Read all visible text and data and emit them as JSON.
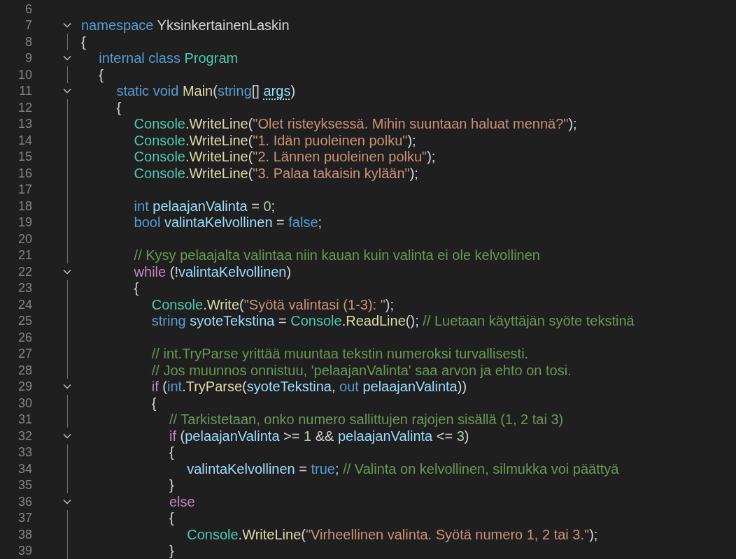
{
  "editor": {
    "lines": [
      {
        "number": "6",
        "fold": false,
        "guide": false
      },
      {
        "number": "7",
        "fold": true,
        "tokens": [
          {
            "kind": "kw",
            "text": "namespace "
          },
          {
            "kind": "plain",
            "text": "YksinkertainenLaskin"
          }
        ]
      },
      {
        "number": "8",
        "fold": false,
        "guide": true,
        "tokens": [
          {
            "kind": "pun",
            "text": "{"
          }
        ],
        "children": [
          {
            "number": "9",
            "fold": true,
            "tokens": [
              {
                "kind": "kw",
                "text": "internal class "
              },
              {
                "kind": "type",
                "text": "Program"
              }
            ]
          },
          {
            "number": "10",
            "fold": false,
            "guide": true,
            "tokens": [
              {
                "kind": "pun",
                "text": "{"
              }
            ],
            "children": [
              {
                "number": "11",
                "fold": true,
                "tokens": [
                  {
                    "kind": "kw",
                    "text": "static void "
                  },
                  {
                    "kind": "fn",
                    "text": "Main"
                  },
                  {
                    "kind": "pun",
                    "text": "("
                  },
                  {
                    "kind": "kw",
                    "text": "string"
                  },
                  {
                    "kind": "pun",
                    "text": "[] "
                  },
                  {
                    "kind": "hint",
                    "text": "args"
                  },
                  {
                    "kind": "pun",
                    "text": ")"
                  }
                ]
              },
              {
                "number": "12",
                "fold": false,
                "guide": true,
                "tokens": [
                  {
                    "kind": "pun",
                    "text": "{"
                  }
                ],
                "children": [
                  {
                    "number": "13",
                    "fold": false,
                    "guide": true,
                    "tokens": [
                      {
                        "kind": "type",
                        "text": "Console"
                      },
                      {
                        "kind": "pun",
                        "text": "."
                      },
                      {
                        "kind": "fn",
                        "text": "WriteLine"
                      },
                      {
                        "kind": "pun",
                        "text": "("
                      },
                      {
                        "kind": "str",
                        "text": "\"Olet risteyksessä. Mihin suuntaan haluat mennä?\""
                      },
                      {
                        "kind": "pun",
                        "text": ");"
                      }
                    ]
                  },
                  {
                    "number": "14",
                    "fold": false,
                    "guide": true,
                    "tokens": [
                      {
                        "kind": "type",
                        "text": "Console"
                      },
                      {
                        "kind": "pun",
                        "text": "."
                      },
                      {
                        "kind": "fn",
                        "text": "WriteLine"
                      },
                      {
                        "kind": "pun",
                        "text": "("
                      },
                      {
                        "kind": "str",
                        "text": "\"1. Idän puoleinen polku\""
                      },
                      {
                        "kind": "pun",
                        "text": ");"
                      }
                    ]
                  },
                  {
                    "number": "15",
                    "fold": false,
                    "guide": true,
                    "tokens": [
                      {
                        "kind": "type",
                        "text": "Console"
                      },
                      {
                        "kind": "pun",
                        "text": "."
                      },
                      {
                        "kind": "fn",
                        "text": "WriteLine"
                      },
                      {
                        "kind": "pun",
                        "text": "("
                      },
                      {
                        "kind": "str",
                        "text": "\"2. Lännen puoleinen polku\""
                      },
                      {
                        "kind": "pun",
                        "text": ");"
                      }
                    ]
                  },
                  {
                    "number": "16",
                    "fold": false,
                    "guide": true,
                    "tokens": [
                      {
                        "kind": "type",
                        "text": "Console"
                      },
                      {
                        "kind": "pun",
                        "text": "."
                      },
                      {
                        "kind": "fn",
                        "text": "WriteLine"
                      },
                      {
                        "kind": "pun",
                        "text": "("
                      },
                      {
                        "kind": "str",
                        "text": "\"3. Palaa takaisin kylään\""
                      },
                      {
                        "kind": "pun",
                        "text": ");"
                      }
                    ]
                  },
                  {
                    "number": "17",
                    "fold": false,
                    "guide": true
                  },
                  {
                    "number": "18",
                    "fold": false,
                    "guide": true,
                    "tokens": [
                      {
                        "kind": "kw",
                        "text": "int "
                      },
                      {
                        "kind": "var",
                        "text": "pelaajanValinta"
                      },
                      {
                        "kind": "pun",
                        "text": " = "
                      },
                      {
                        "kind": "num",
                        "text": "0"
                      },
                      {
                        "kind": "pun",
                        "text": ";"
                      }
                    ]
                  },
                  {
                    "number": "19",
                    "fold": false,
                    "guide": true,
                    "tokens": [
                      {
                        "kind": "kw",
                        "text": "bool "
                      },
                      {
                        "kind": "var",
                        "text": "valintaKelvollinen"
                      },
                      {
                        "kind": "pun",
                        "text": " = "
                      },
                      {
                        "kind": "kw",
                        "text": "false"
                      },
                      {
                        "kind": "pun",
                        "text": ";"
                      }
                    ]
                  },
                  {
                    "number": "20",
                    "fold": false,
                    "guide": true
                  },
                  {
                    "number": "21",
                    "fold": false,
                    "guide": true,
                    "tokens": [
                      {
                        "kind": "cmt",
                        "text": "// Kysy pelaajalta valintaa niin kauan kuin valinta ei ole kelvollinen"
                      }
                    ]
                  },
                  {
                    "number": "22",
                    "fold": true,
                    "tokens": [
                      {
                        "kind": "ctl",
                        "text": "while"
                      },
                      {
                        "kind": "pun",
                        "text": " (!"
                      },
                      {
                        "kind": "var",
                        "text": "valintaKelvollinen"
                      },
                      {
                        "kind": "pun",
                        "text": ")"
                      }
                    ]
                  },
                  {
                    "number": "23",
                    "fold": false,
                    "guide": true,
                    "tokens": [
                      {
                        "kind": "pun",
                        "text": "{"
                      }
                    ],
                    "children": [
                      {
                        "number": "24",
                        "fold": false,
                        "guide": true,
                        "tokens": [
                          {
                            "kind": "type",
                            "text": "Console"
                          },
                          {
                            "kind": "pun",
                            "text": "."
                          },
                          {
                            "kind": "fn",
                            "text": "Write"
                          },
                          {
                            "kind": "pun",
                            "text": "("
                          },
                          {
                            "kind": "str",
                            "text": "\"Syötä valintasi (1-3): \""
                          },
                          {
                            "kind": "pun",
                            "text": ");"
                          }
                        ]
                      },
                      {
                        "number": "25",
                        "fold": false,
                        "guide": true,
                        "tokens": [
                          {
                            "kind": "kw",
                            "text": "string "
                          },
                          {
                            "kind": "var",
                            "text": "syoteTekstina"
                          },
                          {
                            "kind": "pun",
                            "text": " = "
                          },
                          {
                            "kind": "type",
                            "text": "Console"
                          },
                          {
                            "kind": "pun",
                            "text": "."
                          },
                          {
                            "kind": "fn",
                            "text": "ReadLine"
                          },
                          {
                            "kind": "pun",
                            "text": "(); "
                          },
                          {
                            "kind": "cmt",
                            "text": "// Luetaan käyttäjän syöte tekstinä"
                          }
                        ]
                      },
                      {
                        "number": "26",
                        "fold": false,
                        "guide": true
                      },
                      {
                        "number": "27",
                        "fold": false,
                        "guide": true,
                        "tokens": [
                          {
                            "kind": "cmt",
                            "text": "// int.TryParse yrittää muuntaa tekstin numeroksi turvallisesti."
                          }
                        ]
                      },
                      {
                        "number": "28",
                        "fold": false,
                        "guide": true,
                        "tokens": [
                          {
                            "kind": "cmt",
                            "text": "// Jos muunnos onnistuu, 'pelaajanValinta' saa arvon ja ehto on tosi."
                          }
                        ]
                      },
                      {
                        "number": "29",
                        "fold": true,
                        "tokens": [
                          {
                            "kind": "ctl",
                            "text": "if"
                          },
                          {
                            "kind": "pun",
                            "text": " ("
                          },
                          {
                            "kind": "kw",
                            "text": "int"
                          },
                          {
                            "kind": "pun",
                            "text": "."
                          },
                          {
                            "kind": "fn",
                            "text": "TryParse"
                          },
                          {
                            "kind": "pun",
                            "text": "("
                          },
                          {
                            "kind": "var",
                            "text": "syoteTekstina"
                          },
                          {
                            "kind": "pun",
                            "text": ", "
                          },
                          {
                            "kind": "kw",
                            "text": "out "
                          },
                          {
                            "kind": "var",
                            "text": "pelaajanValinta"
                          },
                          {
                            "kind": "pun",
                            "text": "))"
                          }
                        ]
                      },
                      {
                        "number": "30",
                        "fold": false,
                        "guide": true,
                        "tokens": [
                          {
                            "kind": "pun",
                            "text": "{"
                          }
                        ],
                        "children": [
                          {
                            "number": "31",
                            "fold": false,
                            "guide": true,
                            "tokens": [
                              {
                                "kind": "cmt",
                                "text": "// Tarkistetaan, onko numero sallittujen rajojen sisällä (1, 2 tai 3)"
                              }
                            ]
                          },
                          {
                            "number": "32",
                            "fold": true,
                            "tokens": [
                              {
                                "kind": "ctl",
                                "text": "if"
                              },
                              {
                                "kind": "pun",
                                "text": " ("
                              },
                              {
                                "kind": "var",
                                "text": "pelaajanValinta"
                              },
                              {
                                "kind": "pun",
                                "text": " >= "
                              },
                              {
                                "kind": "num",
                                "text": "1"
                              },
                              {
                                "kind": "pun",
                                "text": " && "
                              },
                              {
                                "kind": "var",
                                "text": "pelaajanValinta"
                              },
                              {
                                "kind": "pun",
                                "text": " <= "
                              },
                              {
                                "kind": "num",
                                "text": "3"
                              },
                              {
                                "kind": "pun",
                                "text": ")"
                              }
                            ]
                          },
                          {
                            "number": "33",
                            "fold": false,
                            "guide": true,
                            "tokens": [
                              {
                                "kind": "pun",
                                "text": "{"
                              }
                            ],
                            "children": [
                              {
                                "number": "34",
                                "fold": false,
                                "guide": true,
                                "tokens": [
                                  {
                                    "kind": "var",
                                    "text": "valintaKelvollinen"
                                  },
                                  {
                                    "kind": "pun",
                                    "text": " = "
                                  },
                                  {
                                    "kind": "kw",
                                    "text": "true"
                                  },
                                  {
                                    "kind": "pun",
                                    "text": "; "
                                  },
                                  {
                                    "kind": "cmt",
                                    "text": "// Valinta on kelvollinen, silmukka voi päättyä"
                                  }
                                ]
                              }
                            ]
                          },
                          {
                            "number": "35",
                            "fold": false,
                            "guide": true,
                            "tokens": [
                              {
                                "kind": "pun",
                                "text": "}"
                              }
                            ]
                          },
                          {
                            "number": "36",
                            "fold": true,
                            "tokens": [
                              {
                                "kind": "ctl",
                                "text": "else"
                              }
                            ]
                          },
                          {
                            "number": "37",
                            "fold": false,
                            "guide": true,
                            "tokens": [
                              {
                                "kind": "pun",
                                "text": "{"
                              }
                            ],
                            "children": [
                              {
                                "number": "38",
                                "fold": false,
                                "guide": true,
                                "tokens": [
                                  {
                                    "kind": "type",
                                    "text": "Console"
                                  },
                                  {
                                    "kind": "pun",
                                    "text": "."
                                  },
                                  {
                                    "kind": "fn",
                                    "text": "WriteLine"
                                  },
                                  {
                                    "kind": "pun",
                                    "text": "("
                                  },
                                  {
                                    "kind": "str",
                                    "text": "\"Virheellinen valinta. Syötä numero 1, 2 tai 3.\""
                                  },
                                  {
                                    "kind": "pun",
                                    "text": ");"
                                  }
                                ]
                              }
                            ]
                          },
                          {
                            "number": "39",
                            "fold": false,
                            "guide": true,
                            "tokens": [
                              {
                                "kind": "pun",
                                "text": "}"
                              }
                            ]
                          }
                        ]
                      }
                    ]
                  }
                ]
              }
            ]
          }
        ]
      }
    ]
  }
}
